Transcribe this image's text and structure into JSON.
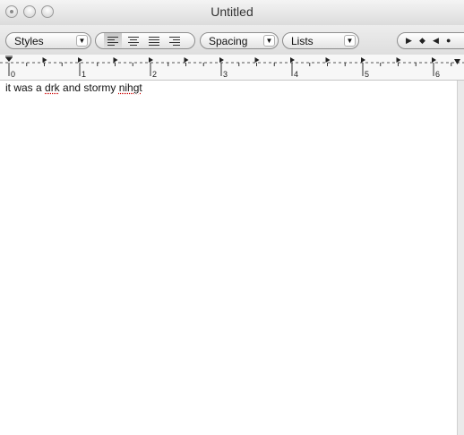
{
  "window": {
    "title": "Untitled"
  },
  "toolbar": {
    "styles_label": "Styles",
    "spacing_label": "Spacing",
    "lists_label": "Lists",
    "alignment": [
      "left",
      "center",
      "justify",
      "right"
    ],
    "alignment_selected": "left",
    "dropdown_arrow_icon": "▼",
    "tab_stop_icons": [
      "▶",
      "◆",
      "◀",
      "●"
    ]
  },
  "ruler": {
    "labels": [
      "0",
      "1",
      "2",
      "3",
      "4",
      "5",
      "6"
    ]
  },
  "document": {
    "words": [
      {
        "text": "it was a ",
        "misspelled": false
      },
      {
        "text": "drk",
        "misspelled": true
      },
      {
        "text": " and stormy ",
        "misspelled": false
      },
      {
        "text": "nihgt",
        "misspelled": true
      }
    ]
  }
}
